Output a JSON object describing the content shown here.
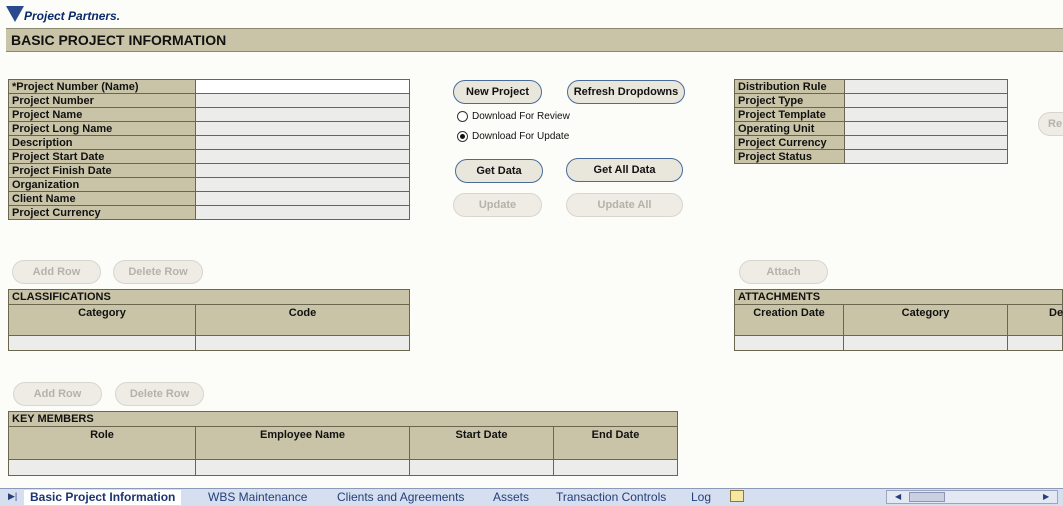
{
  "logo": {
    "text": "Project Partners."
  },
  "page": {
    "title": "BASIC PROJECT INFORMATION"
  },
  "project_fields": [
    "*Project Number (Name)",
    "Project Number",
    "Project Name",
    "Project Long Name",
    "Description",
    "Project Start Date",
    "Project Finish Date",
    "Organization",
    "Client Name",
    "Project Currency"
  ],
  "buttons": {
    "new_project": "New Project",
    "refresh_dropdowns": "Refresh Dropdowns",
    "get_data": "Get Data",
    "get_all_data": "Get All Data",
    "update": "Update",
    "update_all": "Update All",
    "add_row": "Add Row",
    "delete_row": "Delete Row",
    "attach": "Attach",
    "re_partial": "Re"
  },
  "radios": {
    "review": "Download For Review",
    "update": "Download For Update",
    "selected": "update"
  },
  "distribution_fields": [
    "Distribution Rule",
    "Project Type",
    "Project Template",
    "Operating Unit",
    "Project Currency",
    "Project Status"
  ],
  "classifications": {
    "title": "CLASSIFICATIONS",
    "columns": [
      "Category",
      "Code"
    ]
  },
  "attachments": {
    "title": "ATTACHMENTS",
    "columns": [
      "Creation Date",
      "Category",
      "De"
    ]
  },
  "key_members": {
    "title": "KEY MEMBERS",
    "columns": [
      "Role",
      "Employee Name",
      "Start Date",
      "End Date"
    ]
  },
  "sheet_tabs": [
    "Basic Project Information",
    "WBS Maintenance",
    "Clients and Agreements",
    "Assets",
    "Transaction Controls",
    "Log"
  ],
  "active_tab": "Basic Project Information"
}
